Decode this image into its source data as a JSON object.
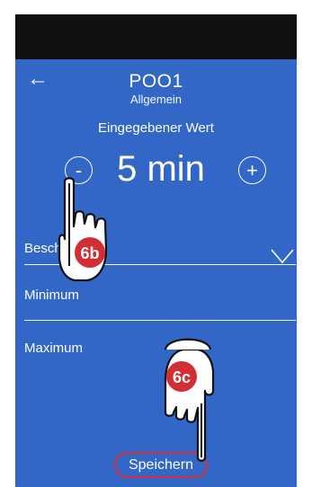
{
  "header": {
    "title": "POO1",
    "subtitle": "Allgemein"
  },
  "entry": {
    "label": "Eingegebener Wert",
    "value": "5 min",
    "decrement_glyph": "-",
    "increment_glyph": "+"
  },
  "fields": {
    "description_label": "Beschreibung",
    "minimum_label": "Minimum",
    "maximum_label": "Maximum"
  },
  "actions": {
    "save_label": "Speichern",
    "back_icon": "arrow-left-icon",
    "dropdown_icon": "chevron-down-icon"
  },
  "annotations": {
    "step_b": "6b",
    "step_c": "6c",
    "highlight_color": "#d42e35"
  },
  "colors": {
    "background": "#3266c7",
    "status_bar": "#101010",
    "text": "#ffffff"
  }
}
